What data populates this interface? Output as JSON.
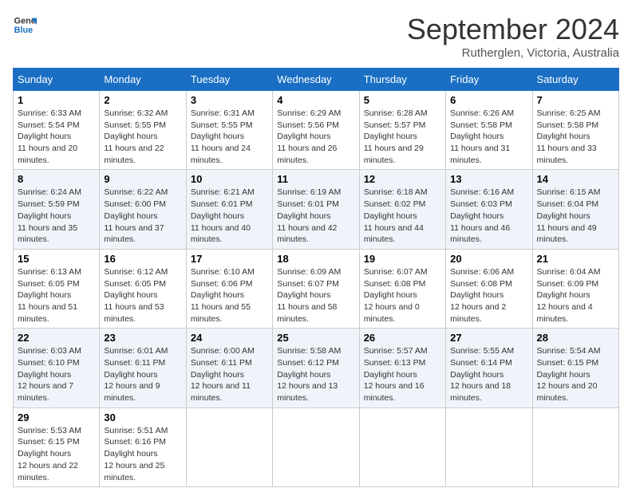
{
  "header": {
    "logo_line1": "General",
    "logo_line2": "Blue",
    "month": "September 2024",
    "location": "Rutherglen, Victoria, Australia"
  },
  "weekdays": [
    "Sunday",
    "Monday",
    "Tuesday",
    "Wednesday",
    "Thursday",
    "Friday",
    "Saturday"
  ],
  "weeks": [
    [
      {
        "day": "1",
        "rise": "6:33 AM",
        "set": "5:54 PM",
        "hours": "11 hours and 20 minutes."
      },
      {
        "day": "2",
        "rise": "6:32 AM",
        "set": "5:55 PM",
        "hours": "11 hours and 22 minutes."
      },
      {
        "day": "3",
        "rise": "6:31 AM",
        "set": "5:55 PM",
        "hours": "11 hours and 24 minutes."
      },
      {
        "day": "4",
        "rise": "6:29 AM",
        "set": "5:56 PM",
        "hours": "11 hours and 26 minutes."
      },
      {
        "day": "5",
        "rise": "6:28 AM",
        "set": "5:57 PM",
        "hours": "11 hours and 29 minutes."
      },
      {
        "day": "6",
        "rise": "6:26 AM",
        "set": "5:58 PM",
        "hours": "11 hours and 31 minutes."
      },
      {
        "day": "7",
        "rise": "6:25 AM",
        "set": "5:58 PM",
        "hours": "11 hours and 33 minutes."
      }
    ],
    [
      {
        "day": "8",
        "rise": "6:24 AM",
        "set": "5:59 PM",
        "hours": "11 hours and 35 minutes."
      },
      {
        "day": "9",
        "rise": "6:22 AM",
        "set": "6:00 PM",
        "hours": "11 hours and 37 minutes."
      },
      {
        "day": "10",
        "rise": "6:21 AM",
        "set": "6:01 PM",
        "hours": "11 hours and 40 minutes."
      },
      {
        "day": "11",
        "rise": "6:19 AM",
        "set": "6:01 PM",
        "hours": "11 hours and 42 minutes."
      },
      {
        "day": "12",
        "rise": "6:18 AM",
        "set": "6:02 PM",
        "hours": "11 hours and 44 minutes."
      },
      {
        "day": "13",
        "rise": "6:16 AM",
        "set": "6:03 PM",
        "hours": "11 hours and 46 minutes."
      },
      {
        "day": "14",
        "rise": "6:15 AM",
        "set": "6:04 PM",
        "hours": "11 hours and 49 minutes."
      }
    ],
    [
      {
        "day": "15",
        "rise": "6:13 AM",
        "set": "6:05 PM",
        "hours": "11 hours and 51 minutes."
      },
      {
        "day": "16",
        "rise": "6:12 AM",
        "set": "6:05 PM",
        "hours": "11 hours and 53 minutes."
      },
      {
        "day": "17",
        "rise": "6:10 AM",
        "set": "6:06 PM",
        "hours": "11 hours and 55 minutes."
      },
      {
        "day": "18",
        "rise": "6:09 AM",
        "set": "6:07 PM",
        "hours": "11 hours and 58 minutes."
      },
      {
        "day": "19",
        "rise": "6:07 AM",
        "set": "6:08 PM",
        "hours": "12 hours and 0 minutes."
      },
      {
        "day": "20",
        "rise": "6:06 AM",
        "set": "6:08 PM",
        "hours": "12 hours and 2 minutes."
      },
      {
        "day": "21",
        "rise": "6:04 AM",
        "set": "6:09 PM",
        "hours": "12 hours and 4 minutes."
      }
    ],
    [
      {
        "day": "22",
        "rise": "6:03 AM",
        "set": "6:10 PM",
        "hours": "12 hours and 7 minutes."
      },
      {
        "day": "23",
        "rise": "6:01 AM",
        "set": "6:11 PM",
        "hours": "12 hours and 9 minutes."
      },
      {
        "day": "24",
        "rise": "6:00 AM",
        "set": "6:11 PM",
        "hours": "12 hours and 11 minutes."
      },
      {
        "day": "25",
        "rise": "5:58 AM",
        "set": "6:12 PM",
        "hours": "12 hours and 13 minutes."
      },
      {
        "day": "26",
        "rise": "5:57 AM",
        "set": "6:13 PM",
        "hours": "12 hours and 16 minutes."
      },
      {
        "day": "27",
        "rise": "5:55 AM",
        "set": "6:14 PM",
        "hours": "12 hours and 18 minutes."
      },
      {
        "day": "28",
        "rise": "5:54 AM",
        "set": "6:15 PM",
        "hours": "12 hours and 20 minutes."
      }
    ],
    [
      {
        "day": "29",
        "rise": "5:53 AM",
        "set": "6:15 PM",
        "hours": "12 hours and 22 minutes."
      },
      {
        "day": "30",
        "rise": "5:51 AM",
        "set": "6:16 PM",
        "hours": "12 hours and 25 minutes."
      },
      null,
      null,
      null,
      null,
      null
    ]
  ]
}
